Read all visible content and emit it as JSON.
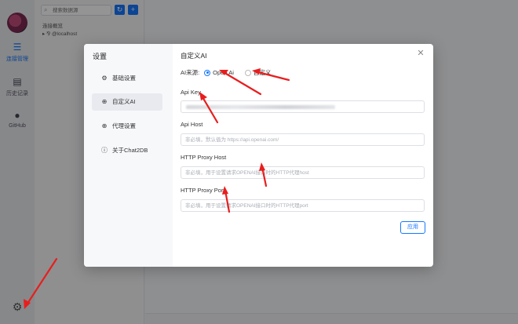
{
  "app": {
    "nav": [
      {
        "label": "连接管理",
        "icon": "database-icon"
      },
      {
        "label": "历史记录",
        "icon": "history-icon"
      },
      {
        "label": "GitHub",
        "icon": "github-icon"
      }
    ],
    "search_placeholder": "搜索数据源",
    "tree": [
      {
        "label": "连接概览"
      },
      {
        "label": "@localhost",
        "prefix": "▸ ⅋"
      }
    ]
  },
  "modal": {
    "title": "设置",
    "menu": [
      {
        "label": "基础设置",
        "icon": "gear-icon"
      },
      {
        "label": "自定义AI",
        "icon": "globe-icon"
      },
      {
        "label": "代理设置",
        "icon": "globe-icon"
      },
      {
        "label": "关于Chat2DB",
        "icon": "info-icon"
      }
    ],
    "section_title": "自定义AI",
    "ai_source_label": "AI来源:",
    "ai_options": [
      "Open Ai",
      "自定义"
    ],
    "api_key_label": "Api Key",
    "api_host_label": "Api Host",
    "api_host_placeholder": "非必填，默认值为 https://api.openai.com/",
    "proxy_host_label": "HTTP Proxy Host",
    "proxy_host_placeholder": "非必填，用于设置请求OPENAI接口时的HTTP代理host",
    "proxy_port_label": "HTTP Proxy Port",
    "proxy_port_placeholder": "非必填，用于设置请求OPENAI接口时的HTTP代理port",
    "apply_label": "应用"
  },
  "colors": {
    "accent": "#1677ff",
    "annotation": "#e81e1e"
  }
}
